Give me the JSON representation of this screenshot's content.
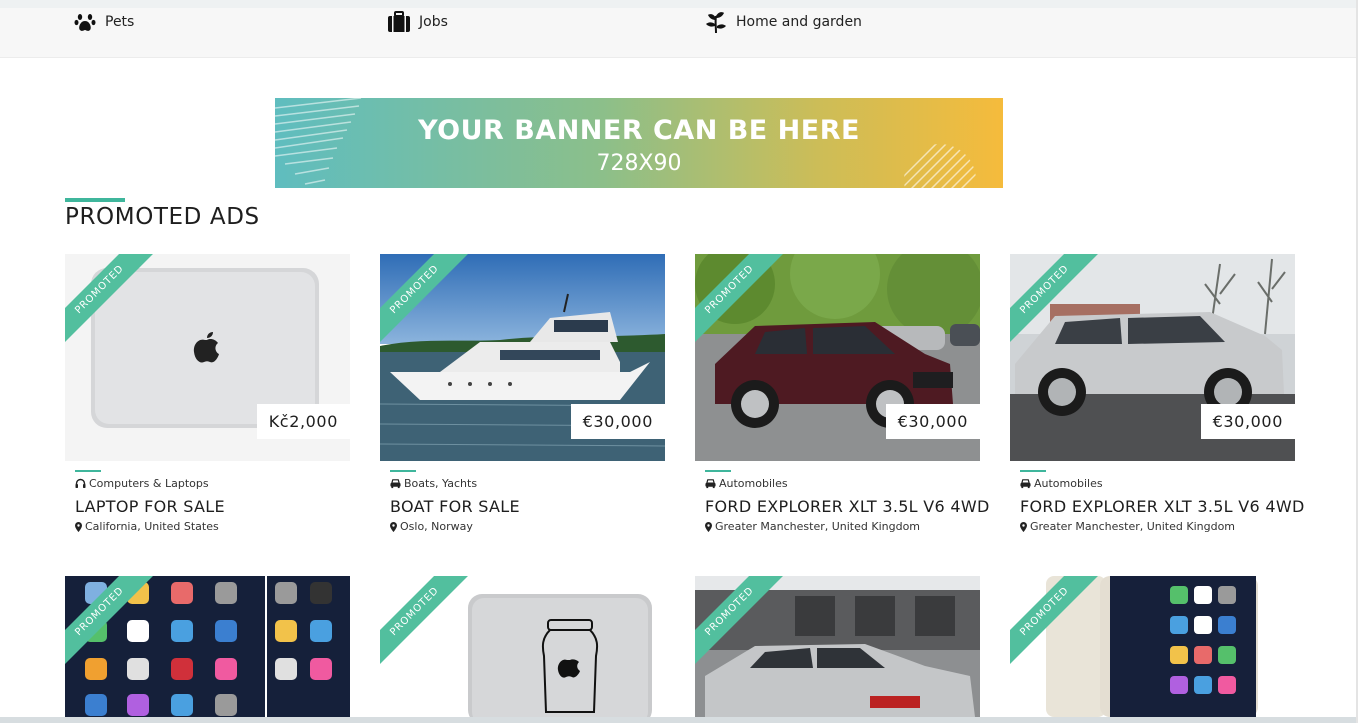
{
  "categories": [
    {
      "label": "Pets",
      "icon": "paw-icon"
    },
    {
      "label": "Jobs",
      "icon": "briefcase-icon"
    },
    {
      "label": "Home and garden",
      "icon": "plant-icon"
    }
  ],
  "banner": {
    "line1": "YOUR BANNER CAN BE HERE",
    "line2": "728X90"
  },
  "section": {
    "title": "PROMOTED ADS"
  },
  "ribbon_label": "PROMOTED",
  "ads": [
    {
      "price": "Kč2,000",
      "category": "Computers & Laptops",
      "category_icon": "headphones-icon",
      "title": "LAPTOP FOR SALE",
      "location": "California, United States"
    },
    {
      "price": "€30,000",
      "category": "Boats, Yachts",
      "category_icon": "car-icon",
      "title": "BOAT FOR SALE",
      "location": "Oslo, Norway"
    },
    {
      "price": "€30,000",
      "category": "Automobiles",
      "category_icon": "car-icon",
      "title": "FORD EXPLORER XLT 3.5L V6 4WD",
      "location": "Greater Manchester, United Kingdom"
    },
    {
      "price": "€30,000",
      "category": "Automobiles",
      "category_icon": "car-icon",
      "title": "FORD EXPLORER XLT 3.5L V6 4WD",
      "location": "Greater Manchester, United Kingdom"
    }
  ],
  "accent_color": "#3fb69c"
}
